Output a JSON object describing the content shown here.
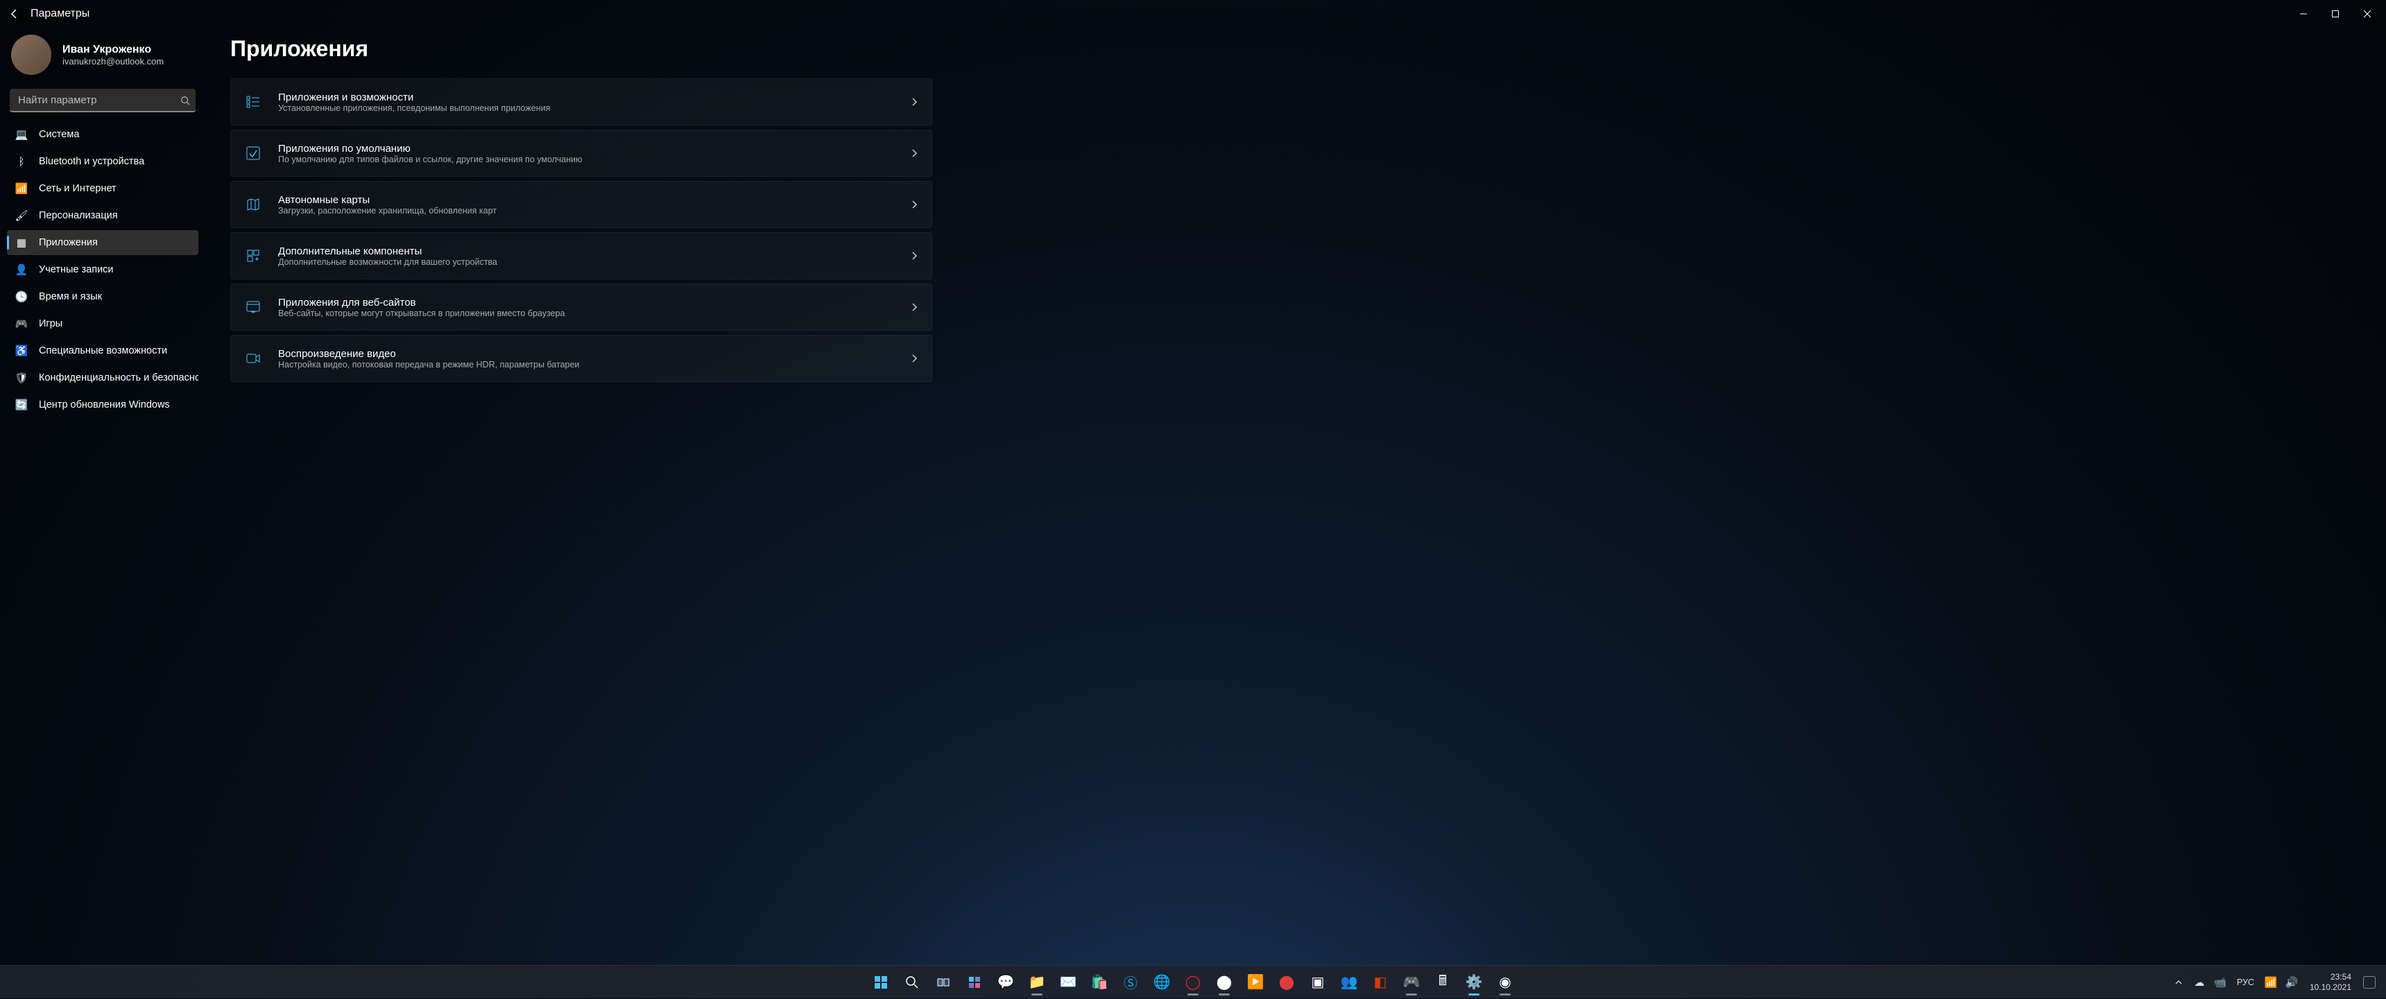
{
  "window": {
    "title": "Параметры"
  },
  "account": {
    "name": "Иван Укроженко",
    "email": "ivanukrozh@outlook.com"
  },
  "search": {
    "placeholder": "Найти параметр"
  },
  "nav": {
    "items": [
      {
        "icon": "💻",
        "label": "Система",
        "key": "system"
      },
      {
        "icon": "ᛒ",
        "label": "Bluetooth и устройства",
        "key": "bluetooth"
      },
      {
        "icon": "📶",
        "label": "Сеть и Интернет",
        "key": "network"
      },
      {
        "icon": "🖌",
        "label": "Персонализация",
        "key": "personalization"
      },
      {
        "icon": "▦",
        "label": "Приложения",
        "key": "apps"
      },
      {
        "icon": "👤",
        "label": "Учетные записи",
        "key": "accounts"
      },
      {
        "icon": "🕓",
        "label": "Время и язык",
        "key": "time"
      },
      {
        "icon": "🎮",
        "label": "Игры",
        "key": "gaming"
      },
      {
        "icon": "♿",
        "label": "Специальные возможности",
        "key": "accessibility"
      },
      {
        "icon": "🛡",
        "label": "Конфиденциальность и безопасность",
        "key": "privacy"
      },
      {
        "icon": "🔄",
        "label": "Центр обновления Windows",
        "key": "update"
      }
    ],
    "active_index": 4
  },
  "page": {
    "title": "Приложения",
    "items": [
      {
        "icon_name": "apps-list-icon",
        "title": "Приложения и возможности",
        "desc": "Установленные приложения, псевдонимы выполнения приложения"
      },
      {
        "icon_name": "apps-default-icon",
        "title": "Приложения по умолчанию",
        "desc": "По умолчанию для типов файлов и ссылок, другие значения по умолчанию"
      },
      {
        "icon_name": "maps-icon",
        "title": "Автономные карты",
        "desc": "Загрузки, расположение хранилища, обновления карт"
      },
      {
        "icon_name": "components-icon",
        "title": "Дополнительные компоненты",
        "desc": "Дополнительные возможности для вашего устройства"
      },
      {
        "icon_name": "websites-icon",
        "title": "Приложения для веб-сайтов",
        "desc": "Веб-сайты, которые могут открываться в приложении вместо браузера"
      },
      {
        "icon_name": "video-icon",
        "title": "Воспроизведение видео",
        "desc": "Настройка видео, потоковая передача в режиме HDR, параметры батареи"
      }
    ]
  },
  "taskbar": {
    "tray": {
      "lang": "РУС",
      "time": "23:54",
      "date": "10.10.2021"
    }
  }
}
